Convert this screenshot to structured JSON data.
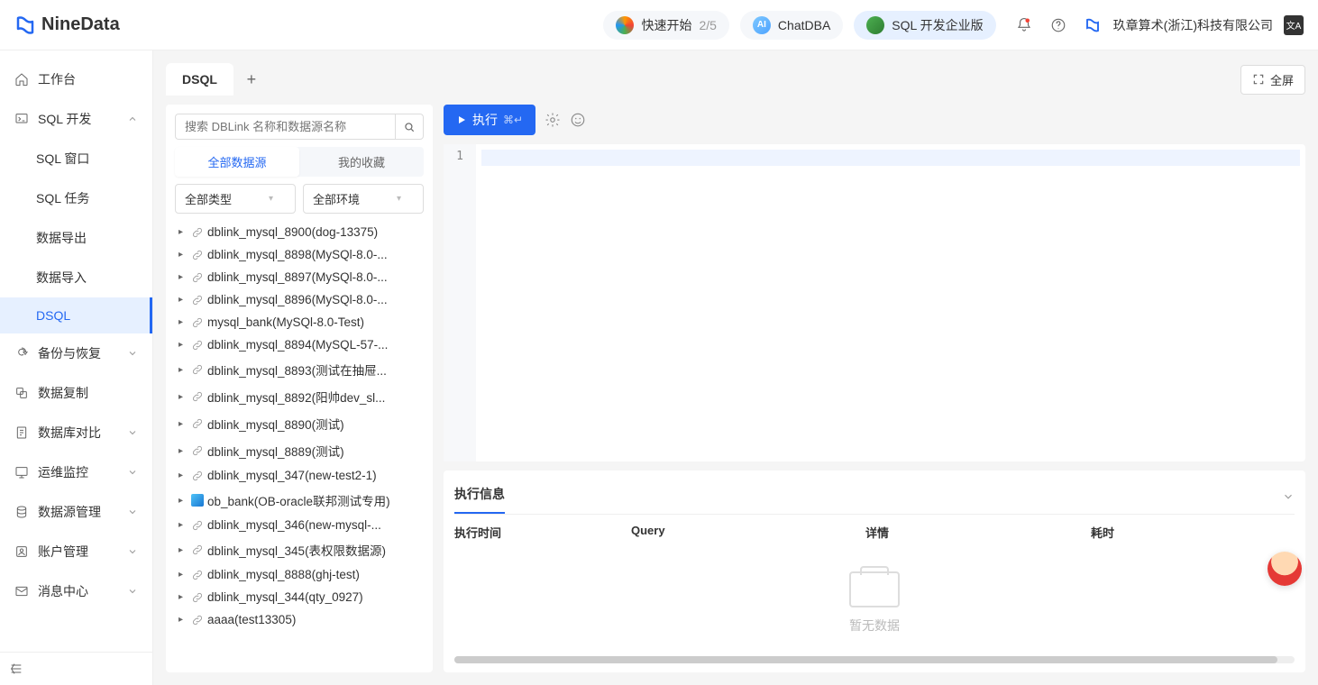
{
  "brand": {
    "name": "NineData"
  },
  "header": {
    "quickstart": {
      "label": "快速开始",
      "progress": "2/5"
    },
    "chatdba": {
      "label": "ChatDBA"
    },
    "edition": {
      "label": "SQL 开发企业版"
    },
    "org": "玖章算术(浙江)科技有限公司",
    "lang": "文A"
  },
  "sidebar": {
    "workspace": "工作台",
    "sql_dev": "SQL 开发",
    "sql_window": "SQL 窗口",
    "sql_task": "SQL 任务",
    "data_export": "数据导出",
    "data_import": "数据导入",
    "dsql": "DSQL",
    "backup": "备份与恢复",
    "replication": "数据复制",
    "compare": "数据库对比",
    "ops": "运维监控",
    "datasource_mgmt": "数据源管理",
    "account": "账户管理",
    "message": "消息中心"
  },
  "tabs": {
    "main": "DSQL"
  },
  "fullscreen": "全屏",
  "tree": {
    "search_placeholder": "搜索 DBLink 名称和数据源名称",
    "tab_all": "全部数据源",
    "tab_fav": "我的收藏",
    "filter_type": "全部类型",
    "filter_env": "全部环境",
    "items": [
      "dblink_mysql_8900(dog-13375)",
      "dblink_mysql_8898(MySQl-8.0-...",
      "dblink_mysql_8897(MySQl-8.0-...",
      "dblink_mysql_8896(MySQl-8.0-...",
      "mysql_bank(MySQl-8.0-Test)",
      "dblink_mysql_8894(MySQL-57-...",
      "dblink_mysql_8893(测试在抽屉...",
      "dblink_mysql_8892(阳帅dev_sl...",
      "dblink_mysql_8890(测试)",
      "dblink_mysql_8889(测试)",
      "dblink_mysql_347(new-test2-1)",
      "ob_bank(OB-oracle联邦测试专用)",
      "dblink_mysql_346(new-mysql-...",
      "dblink_mysql_345(表权限数据源)",
      "dblink_mysql_8888(ghj-test)",
      "dblink_mysql_344(qty_0927)",
      "aaaa(test13305)"
    ]
  },
  "toolbar": {
    "run": "执行",
    "shortcut": "⌘↵"
  },
  "editor": {
    "line1": "1"
  },
  "results": {
    "title": "执行信息",
    "col_time": "执行时间",
    "col_query": "Query",
    "col_detail": "详情",
    "col_duration": "耗时",
    "empty": "暂无数据"
  }
}
